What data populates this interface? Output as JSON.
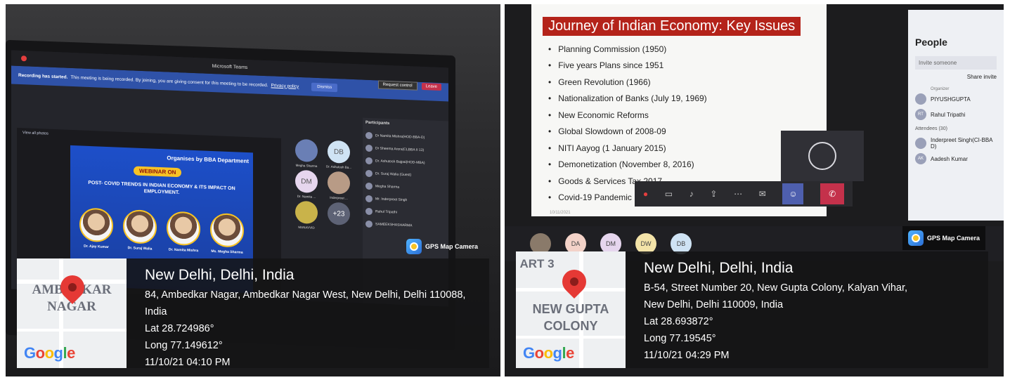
{
  "left_photo": {
    "teams": {
      "window_title": "Microsoft Teams",
      "request_control": "Request control",
      "leave": "Leave",
      "recording_banner_bold": "Recording has started.",
      "recording_banner_text": "This meeting is being recorded. By joining, you are giving consent for this meeting to be recorded.",
      "privacy_link": "Privacy policy",
      "dismiss": "Dismiss",
      "view_all_photos": "View all photos",
      "participants_title": "Participants",
      "participants": [
        "Dr Namita Mishra(HOD-BBA-D)",
        "Dr Sheema Arora(CLBBA II 13)",
        "Dr. Ashutosh Bajpai(HOD-MBA)",
        "Dr. Suraj Walia (Guest)",
        "Megha Sharma",
        "Mr. Inderpreet Singh",
        "Rahul Tripathi",
        "SAMEEKSHASHARMA"
      ]
    },
    "poster": {
      "org_line": "Organises by BBA Department",
      "badge": "WEBINAR ON",
      "title": "POST- COVID TRENDS IN INDIAN ECONOMY & ITS IMPACT ON EMPLOYMENT.",
      "speakers": [
        "Dr. Ajay Kumar",
        "Dr. Suraj Walia",
        "Dr. Namita Mishra",
        "Ms. Megha Sharma"
      ]
    },
    "gallery": [
      {
        "name": "Megha Sharma",
        "initials": ""
      },
      {
        "name": "Dr. Ashutosh Ba...",
        "initials": "DB"
      },
      {
        "name": "Dr. Namita ...",
        "initials": "DM"
      },
      {
        "name": "Inderpreet ...",
        "initials": ""
      },
      {
        "name": "MANAVVID",
        "initials": ""
      },
      {
        "name": "",
        "initials": "+23"
      }
    ],
    "gps_camera_label": "GPS Map Camera",
    "gps": {
      "city": "New Delhi, Delhi, India",
      "address": "84, Ambedkar Nagar, Ambedkar Nagar West, New Delhi, Delhi 110088, India",
      "lat": "Lat 28.724986°",
      "long": "Long 77.149612°",
      "datetime": "11/10/21 04:10 PM",
      "map_label_1": "AMBEDKAR",
      "map_label_2": "NAGAR"
    }
  },
  "right_photo": {
    "slide": {
      "title": "Journey of Indian Economy: Key Issues",
      "bullets": [
        "Planning Commission (1950)",
        "Five years Plans since 1951",
        "Green Revolution (1966)",
        "Nationalization of Banks (July 19, 1969)",
        "New Economic Reforms",
        "Global Slowdown of 2008-09",
        "NITI Aayog (1 January 2015)",
        "Demonetization  (November 8, 2016)",
        "Goods & Services Tax 2017",
        "Covid-19 Pandemic"
      ],
      "date": "10/11/2021"
    },
    "people_panel": {
      "title": "People",
      "invite_placeholder": "Invite someone",
      "share_invite": "Share invite",
      "organizer_label": "Organizer",
      "members": [
        {
          "initials": "",
          "name": "PIYUSHGUPTA"
        },
        {
          "initials": "RT",
          "name": "Rahul Tripathi"
        }
      ],
      "attendees_label": "Attendees (30)",
      "attendees": [
        {
          "initials": "",
          "name": "Inderpreet Singh(CI-BBA D)"
        },
        {
          "initials": "AK",
          "name": "Aadesh Kumar"
        }
      ]
    },
    "strip": [
      {
        "initials": ""
      },
      {
        "initials": "DA"
      },
      {
        "initials": "DM"
      },
      {
        "initials": "DW"
      },
      {
        "initials": "DB"
      }
    ],
    "gps_camera_label": "GPS Map Camera",
    "gps": {
      "city": "New Delhi, Delhi, India",
      "address_line1": "B-54, Street Number 20, New Gupta Colony, Kalyan Vihar,",
      "address_line2": "New Delhi, Delhi 110009, India",
      "lat": "Lat 28.693872°",
      "long": "Long 77.19545°",
      "datetime": "11/10/21 04:29 PM",
      "map_label_1": "NEW GUPTA",
      "map_label_2": "COLONY",
      "map_corner": "ART 3"
    }
  },
  "colors": {
    "teams_banner": "#2f52a8",
    "slide_title_bg": "#b4231a",
    "leave_button": "#c4314b",
    "map_pin": "#e53935"
  },
  "icons": [
    "record-dot-icon",
    "map-pin-icon",
    "gps-camera-icon",
    "google-logo",
    "camera-off-icon",
    "mic-off-icon",
    "share-screen-icon",
    "more-icon",
    "chat-icon",
    "people-icon",
    "hang-up-icon"
  ]
}
